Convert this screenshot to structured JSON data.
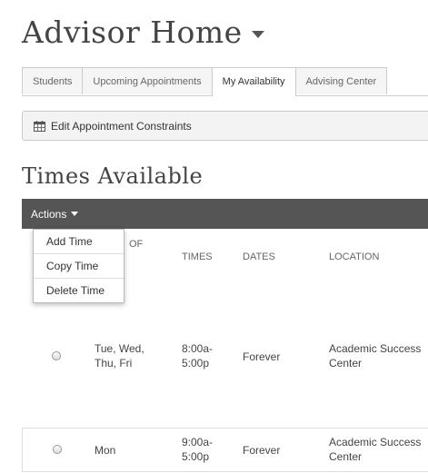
{
  "header": {
    "title": "Advisor Home"
  },
  "tabs": [
    {
      "label": "Students"
    },
    {
      "label": "Upcoming Appointments"
    },
    {
      "label": "My Availability"
    },
    {
      "label": "Advising Center"
    }
  ],
  "toolbar": {
    "edit_label": "Edit Appointment Constraints"
  },
  "section": {
    "title": "Times Available"
  },
  "actions": {
    "label": "Actions",
    "menu": [
      {
        "label": "Add Time"
      },
      {
        "label": "Copy Time"
      },
      {
        "label": "Delete Time"
      }
    ]
  },
  "table": {
    "columns": {
      "days_fragment": "OF",
      "times": "TIMES",
      "dates": "DATES",
      "location": "LOCATION"
    },
    "rows": [
      {
        "days": [
          "Tue, Wed,",
          "Thu, Fri"
        ],
        "times": [
          "8:00a-",
          "5:00p"
        ],
        "dates": "Forever",
        "location": [
          "Academic Success",
          "Center"
        ]
      },
      {
        "days": [
          "Mon"
        ],
        "times": [
          "9:00a-",
          "5:00p"
        ],
        "dates": "Forever",
        "location": [
          "Academic Success",
          "Center"
        ]
      }
    ]
  }
}
